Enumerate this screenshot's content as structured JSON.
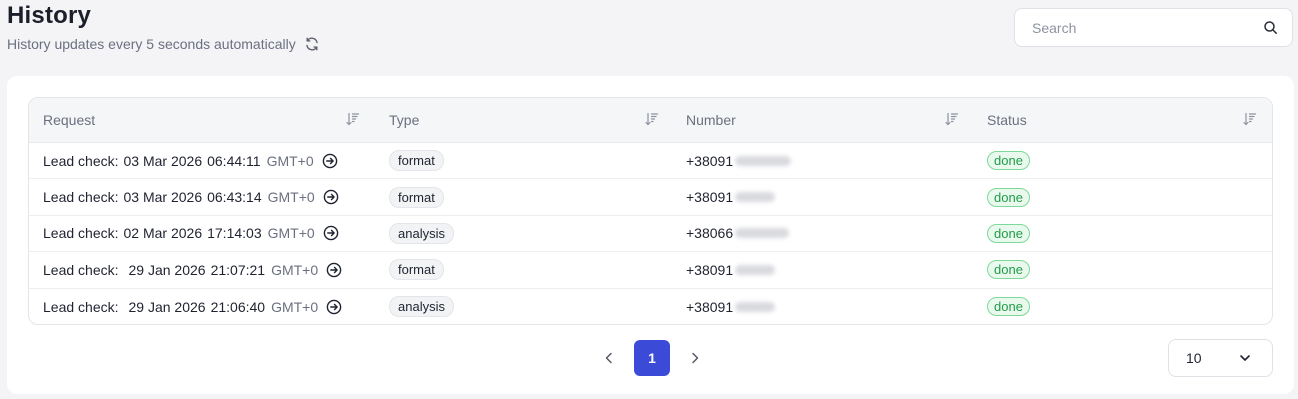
{
  "header": {
    "title": "History",
    "subtitle": "History updates every 5 seconds automatically",
    "refresh_icon": "refresh-icon"
  },
  "search": {
    "placeholder": "Search",
    "icon": "search-icon"
  },
  "table": {
    "columns": [
      {
        "label": "Request",
        "sort_icon": "sort-icon"
      },
      {
        "label": "Type",
        "sort_icon": "sort-icon"
      },
      {
        "label": "Number",
        "sort_icon": "sort-icon"
      },
      {
        "label": "Status",
        "sort_icon": "sort-icon"
      }
    ],
    "rows": [
      {
        "prefix": "Lead check:",
        "date": "03 Mar 2026",
        "time": "06:44:11",
        "tz": "GMT+0",
        "type": "format",
        "number": "+38091",
        "status": "done"
      },
      {
        "prefix": "Lead check:",
        "date": "03 Mar 2026",
        "time": "06:43:14",
        "tz": "GMT+0",
        "type": "format",
        "number": "+38091",
        "status": "done"
      },
      {
        "prefix": "Lead check:",
        "date": "02 Mar 2026",
        "time": "17:14:03",
        "tz": "GMT+0",
        "type": "analysis",
        "number": "+38066",
        "status": "done"
      },
      {
        "prefix": "Lead check:",
        "date": "29 Jan 2026",
        "time": "21:07:21",
        "tz": "GMT+0",
        "type": "format",
        "number": "+38091",
        "status": "done"
      },
      {
        "prefix": "Lead check:",
        "date": "29 Jan 2026",
        "time": "21:06:40",
        "tz": "GMT+0",
        "type": "analysis",
        "number": "+38091",
        "status": "done"
      }
    ]
  },
  "pagination": {
    "current_page": "1",
    "prev_icon": "chevron-left-icon",
    "next_icon": "chevron-right-icon"
  },
  "per_page": {
    "value": "10",
    "icon": "chevron-down-icon"
  },
  "colors": {
    "accent": "#3b4bd8",
    "status_done_text": "#1f9d48",
    "status_done_border": "#7cd99a"
  }
}
